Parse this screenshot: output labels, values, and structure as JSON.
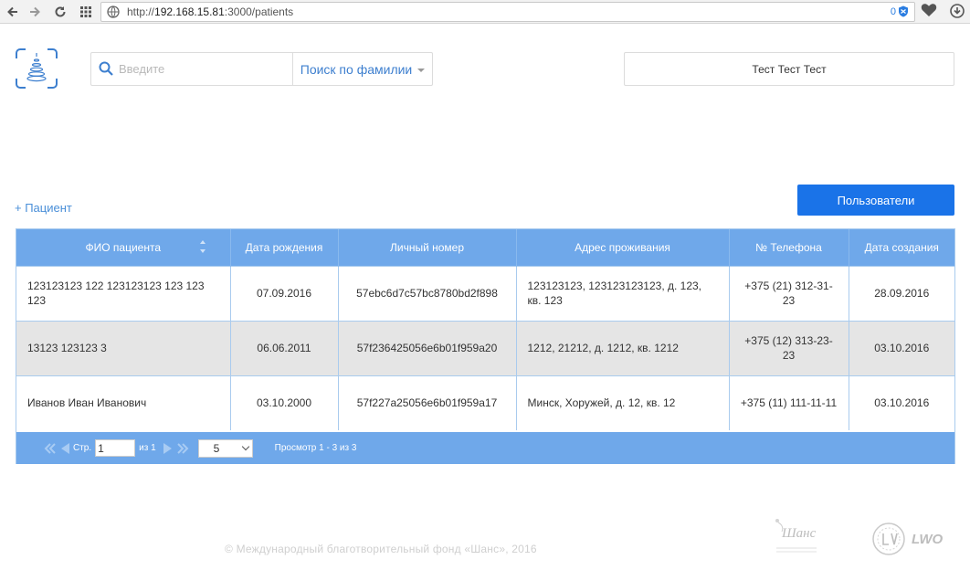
{
  "browser": {
    "url_protocol": "http://",
    "url_host": "192.168.15.81",
    "url_path": ":3000/patients",
    "badge_count": "0"
  },
  "search": {
    "placeholder": "Введите",
    "mode_label": "Поиск по фамилии"
  },
  "user": {
    "name": "Тест Тест Тест"
  },
  "actions": {
    "add_patient": "+ Пациент",
    "users": "Пользователи"
  },
  "table": {
    "columns": [
      "ФИО пациента",
      "Дата рождения",
      "Личный номер",
      "Адрес проживания",
      "№ Телефона",
      "Дата создания"
    ],
    "rows": [
      [
        "123123123 122 123123123 123 123 123",
        "07.09.2016",
        "57ebc6d7c57bc8780bd2f898",
        "123123123, 123123123123, д. 123, кв. 123",
        "+375 (21) 312-31-23",
        "28.09.2016"
      ],
      [
        "13123 123123 3",
        "06.06.2011",
        "57f236425056e6b01f959a20",
        "1212, 21212, д. 1212, кв. 1212",
        "+375 (12) 313-23-23",
        "03.10.2016"
      ],
      [
        "Иванов Иван  Иванович",
        "03.10.2000",
        "57f227a25056e6b01f959a17",
        "Минск, Хоружей, д. 12, кв. 12",
        "+375 (11) 111-11-11",
        "03.10.2016"
      ]
    ]
  },
  "pager": {
    "page_label": "Стр.",
    "page_value": "1",
    "of_label": "из 1",
    "page_size": "5",
    "info": "Просмотр 1 - 3 из 3"
  },
  "footer": {
    "copyright": "© Международный благотворительный фонд «Шанс», 2016",
    "chance_logo_text": "Шанс",
    "lwo_text": "LWO"
  },
  "colors": {
    "accent": "#1a73e8",
    "table_header": "#6fa8ea",
    "link": "#4a8fd8"
  }
}
